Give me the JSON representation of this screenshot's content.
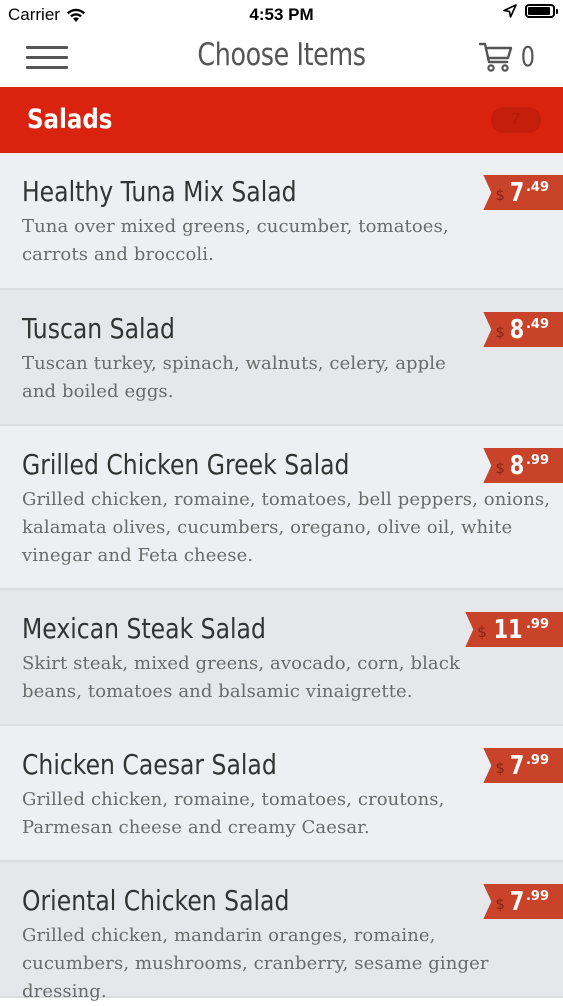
{
  "status_bar": {
    "carrier": "Carrier",
    "time": "4:53 PM"
  },
  "nav": {
    "title": "Choose Items",
    "cart_count": "0"
  },
  "category": {
    "title": "Salads",
    "badge": "7"
  },
  "colors": {
    "accent": "#d9230f",
    "price_tag": "#c9432b"
  },
  "items": [
    {
      "name": "Healthy Tuna Mix Salad",
      "description": "Tuna over mixed greens, cucumber, tomatoes, carrots and broccoli.",
      "price_currency": "$",
      "price_whole": "7",
      "price_cents": ".49"
    },
    {
      "name": "Tuscan Salad",
      "description": "Tuscan turkey, spinach, walnuts, celery, apple and boiled eggs.",
      "price_currency": "$",
      "price_whole": "8",
      "price_cents": ".49"
    },
    {
      "name": "Grilled Chicken Greek Salad",
      "description": "Grilled chicken, romaine, tomatoes, bell peppers, onions, kalamata olives, cucumbers, oregano, olive oil, white vinegar and Feta cheese.",
      "price_currency": "$",
      "price_whole": "8",
      "price_cents": ".99"
    },
    {
      "name": "Mexican Steak Salad",
      "description": "Skirt steak, mixed greens, avocado, corn, black beans, tomatoes and balsamic vinaigrette.",
      "price_currency": "$",
      "price_whole": "11",
      "price_cents": ".99"
    },
    {
      "name": "Chicken Caesar Salad",
      "description": "Grilled chicken, romaine, tomatoes, croutons, Parmesan cheese and creamy Caesar.",
      "price_currency": "$",
      "price_whole": "7",
      "price_cents": ".99"
    },
    {
      "name": "Oriental Chicken Salad",
      "description": "Grilled chicken, mandarin oranges, romaine, cucumbers, mushrooms, cranberry, sesame ginger dressing.",
      "price_currency": "$",
      "price_whole": "7",
      "price_cents": ".99"
    }
  ]
}
